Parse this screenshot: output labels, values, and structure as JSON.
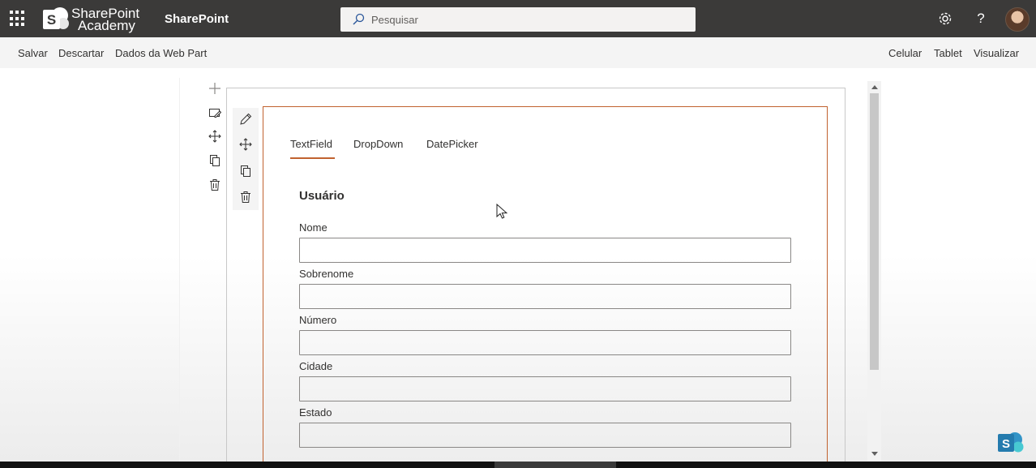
{
  "suite_bar": {
    "logo_line1": "SharePoint",
    "logo_line2": "Academy",
    "logo_letter": "S",
    "app_name": "SharePoint",
    "search_placeholder": "Pesquisar",
    "icons": [
      "waffle-icon",
      "search-icon",
      "gear-icon",
      "help-icon"
    ],
    "help_glyph": "?",
    "background_color": "#3b3a39"
  },
  "command_bar": {
    "left": [
      "Salvar",
      "Descartar",
      "Dados da Web Part"
    ],
    "right": [
      "Celular",
      "Tablet",
      "Visualizar"
    ]
  },
  "section_toolbar": {
    "icons": [
      "add-section-icon",
      "edit-section-icon",
      "move-icon",
      "duplicate-icon",
      "delete-icon"
    ]
  },
  "webpart_toolbar": {
    "icons": [
      "edit-pencil-icon",
      "move-icon",
      "duplicate-icon",
      "delete-icon"
    ]
  },
  "webpart": {
    "accent_color": "#c1622f",
    "tabs": [
      {
        "label": "TextField",
        "active": true
      },
      {
        "label": "DropDown",
        "active": false
      },
      {
        "label": "DatePicker",
        "active": false
      }
    ],
    "form_title": "Usuário",
    "fields": [
      {
        "label": "Nome",
        "value": ""
      },
      {
        "label": "Sobrenome",
        "value": ""
      },
      {
        "label": "Número",
        "value": ""
      },
      {
        "label": "Cidade",
        "value": ""
      },
      {
        "label": "Estado",
        "value": ""
      }
    ]
  }
}
